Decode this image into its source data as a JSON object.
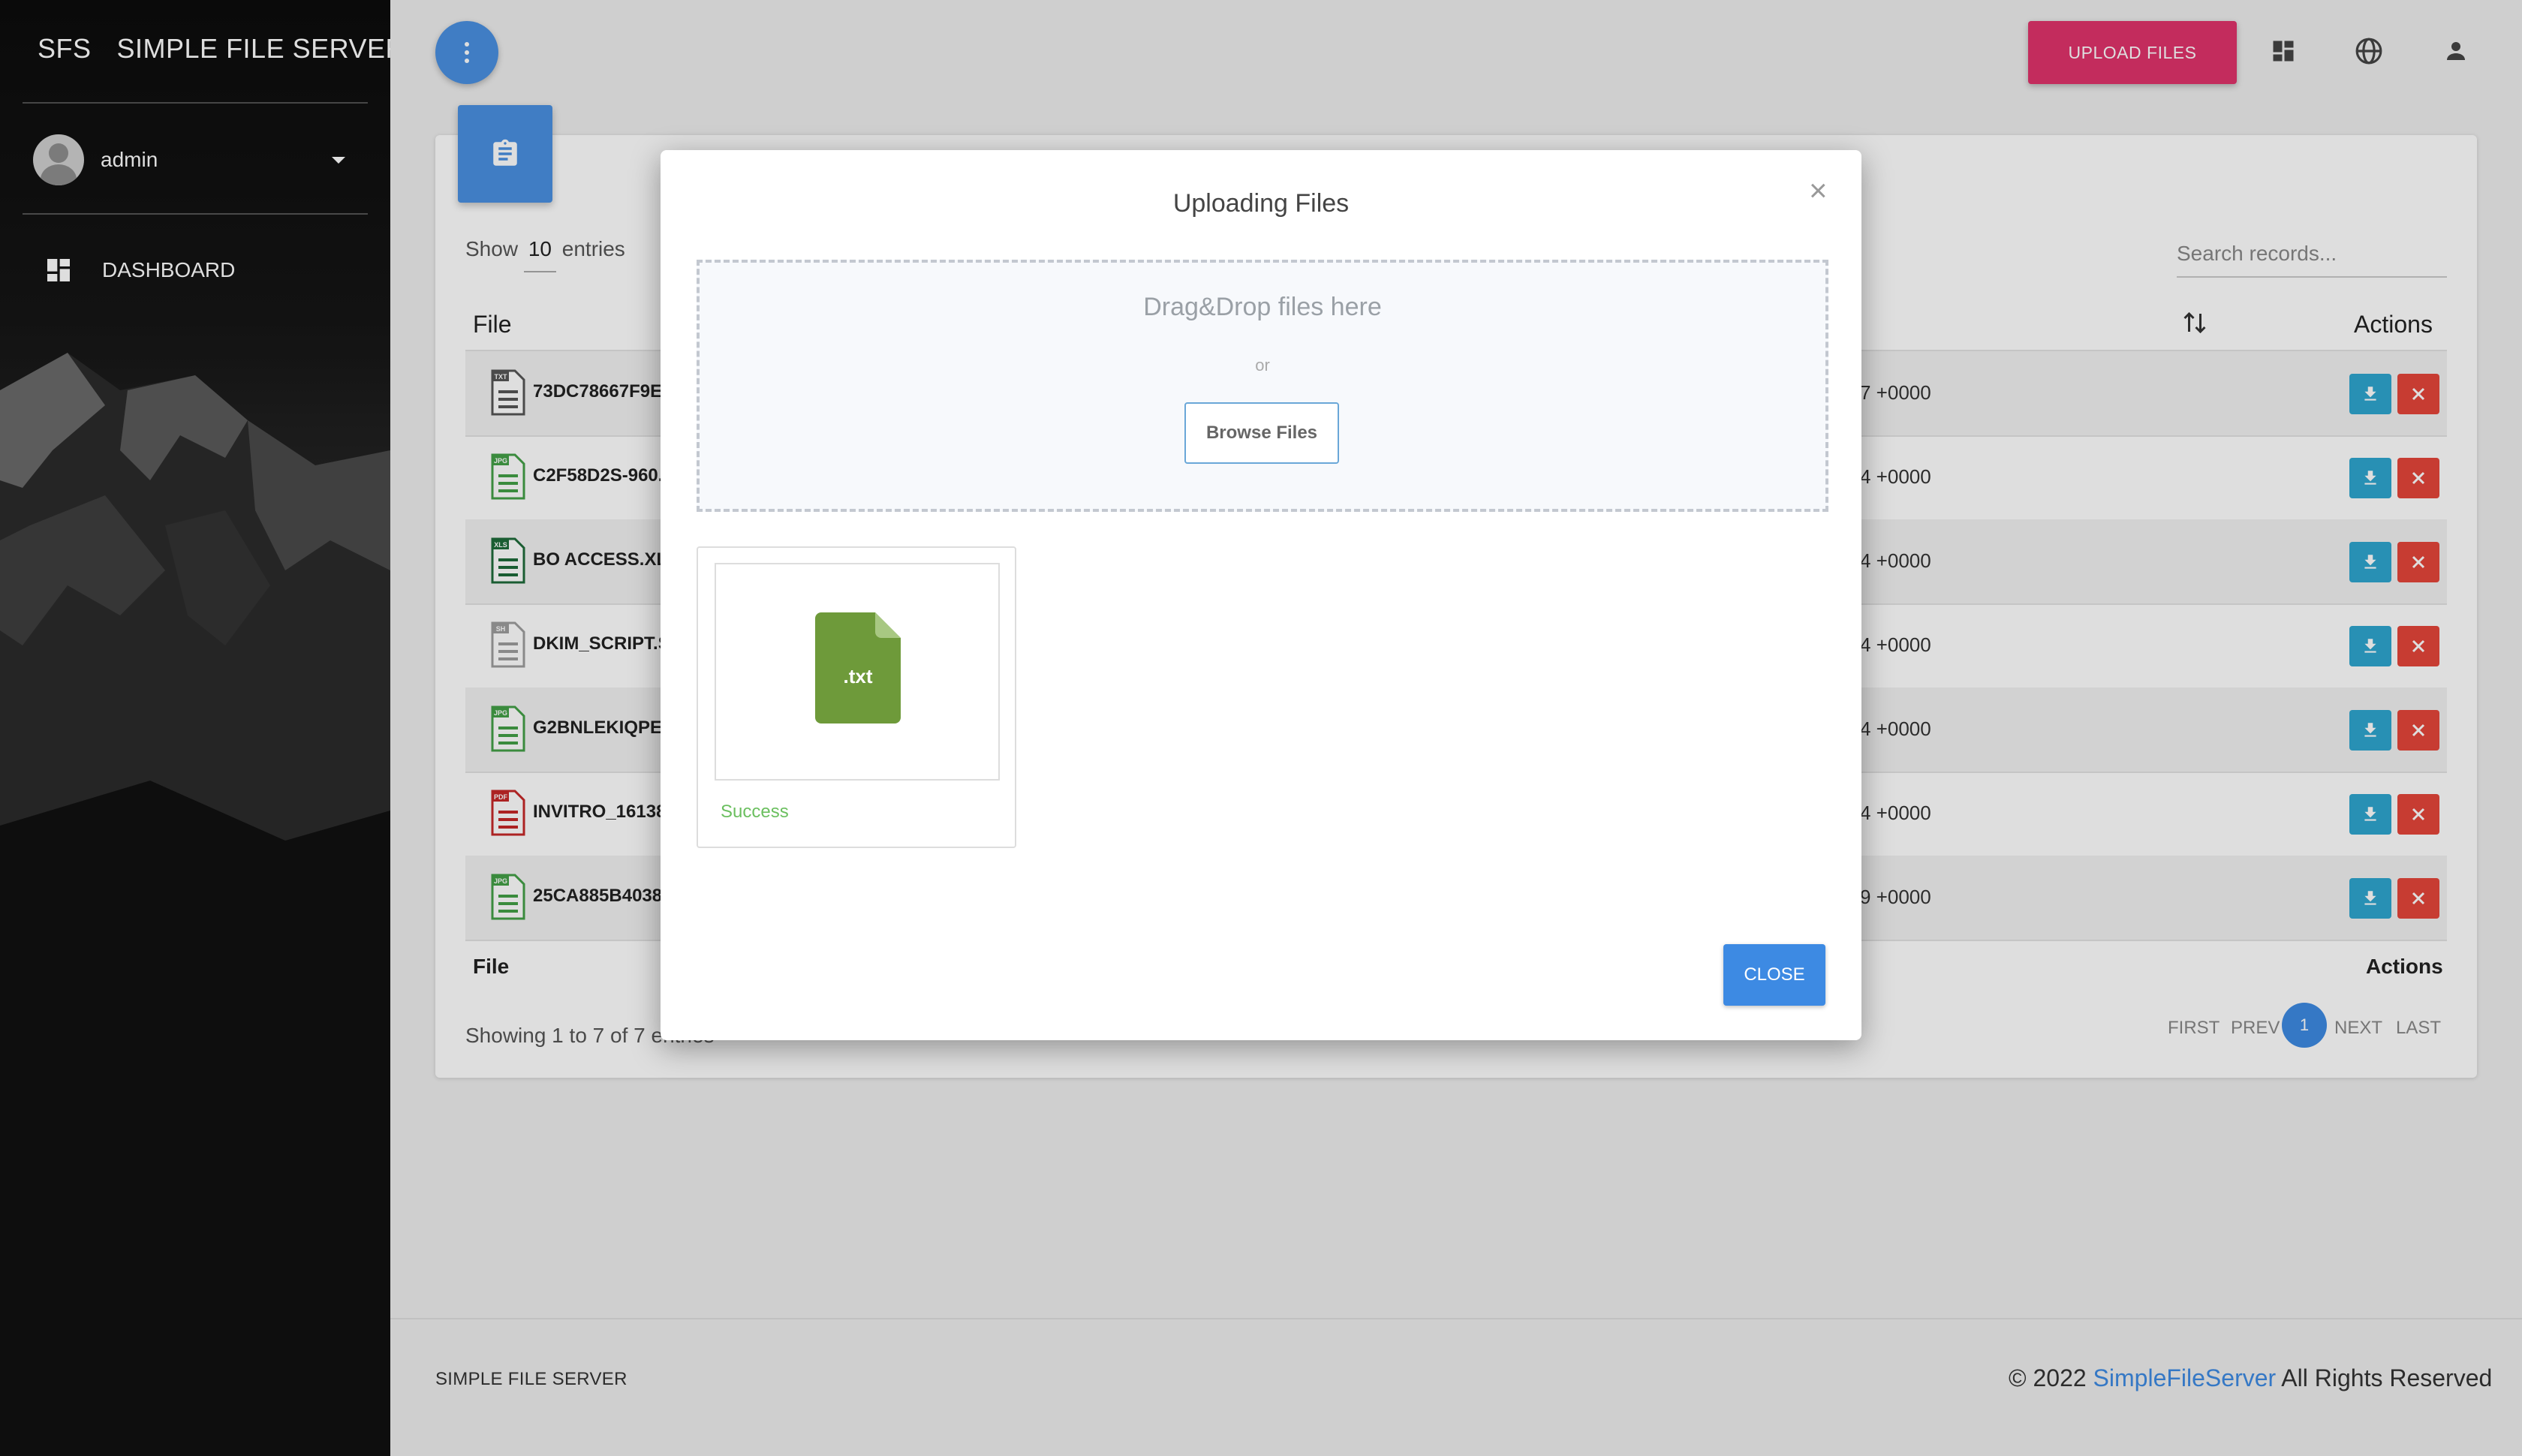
{
  "sidebar": {
    "brand_short": "SFS",
    "brand_full": "SIMPLE FILE SERVER",
    "user": "admin",
    "nav": [
      {
        "label": "DASHBOARD",
        "icon": "dashboard-icon"
      }
    ]
  },
  "toolbar": {
    "upload_label": "UPLOAD FILES",
    "icons": [
      "dashboard-icon",
      "globe-icon",
      "user-icon"
    ],
    "accent_color": "#e0336b"
  },
  "table": {
    "show_prefix": "Show",
    "show_count": "10",
    "show_suffix": "entries",
    "search_placeholder": "Search records...",
    "col_file": "File",
    "col_actions": "Actions",
    "rows": [
      {
        "name": "73DC78667F9E",
        "type": "TXT",
        "date": "7 +0000"
      },
      {
        "name": "C2F58D2S-960.",
        "type": "JPG",
        "date": "4 +0000"
      },
      {
        "name": "BO ACCESS.XLS",
        "type": "XLS",
        "date": "4 +0000"
      },
      {
        "name": "DKIM_SCRIPT.S",
        "type": "SH",
        "date": "4 +0000"
      },
      {
        "name": "G2BNLEKIQPE.J",
        "type": "JPG",
        "date": "4 +0000"
      },
      {
        "name": "INVITRO_16138",
        "type": "PDF",
        "date": "4 +0000"
      },
      {
        "name": "25CA885B4038",
        "type": "JPG",
        "date": "9 +0000"
      }
    ],
    "foot_file": "File",
    "foot_actions": "Actions",
    "showing": "Showing 1 to 7 of 7 entries",
    "pager": {
      "first": "FIRST",
      "prev": "PREV",
      "current": "1",
      "next": "NEXT",
      "last": "LAST"
    }
  },
  "footer": {
    "left": "SIMPLE FILE SERVER",
    "copy": "© 2022",
    "link": "SimpleFileServer",
    "rights": "All Rights Reserved"
  },
  "modal": {
    "title": "Uploading Files",
    "close_x": "×",
    "dropzone_text": "Drag&Drop files here",
    "or": "or",
    "browse_label": "Browse Files",
    "file_ext": ".txt",
    "status": "Success",
    "close_label": "CLOSE"
  }
}
